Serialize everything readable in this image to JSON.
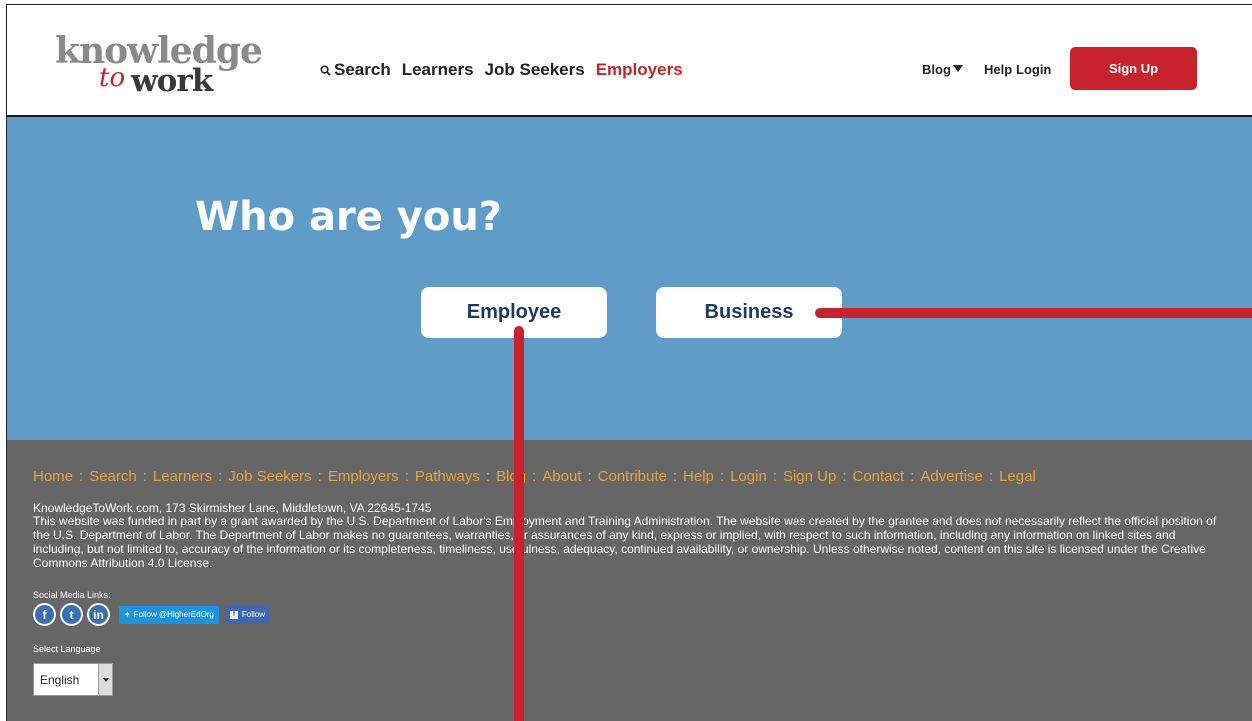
{
  "header": {
    "logo": {
      "top": "knowledge",
      "to": "to",
      "work": "work"
    },
    "nav": [
      {
        "label": "Search",
        "active": false,
        "icon": "search-icon"
      },
      {
        "label": "Learners",
        "active": false
      },
      {
        "label": "Job Seekers",
        "active": false
      },
      {
        "label": "Employers",
        "active": true
      }
    ],
    "right_nav": {
      "blog": "Blog",
      "help": "Help",
      "login": "Login"
    },
    "signup": "Sign Up"
  },
  "hero": {
    "title": "Who are you?",
    "employee": "Employee",
    "business": "Business"
  },
  "footer": {
    "links": [
      "Home",
      "Search",
      "Learners",
      "Job Seekers",
      "Employers",
      "Pathways",
      "Blog",
      "About",
      "Contribute",
      "Help",
      "Login",
      "Sign Up",
      "Contact",
      "Advertise",
      "Legal"
    ],
    "address": "KnowledgeToWork.com, 173 Skirmisher Lane, Middletown, VA 22645-1745",
    "disclaimer": "This website was funded in part by a grant awarded by the U.S. Department of Labor's Employment and Training Administration. The website was created by the grantee and does not necessarily reflect the official position of the U.S. Department of Labor. The Department of Labor makes no guarantees, warranties, or assurances of any kind, express or implied, with respect to such information, including any information on linked sites and including, but not limited to, accuracy of the information or its completeness, timeliness, usefulness, adequacy, continued availability, or ownership. Unless otherwise noted, content on this site is licensed under the Creative Commons Attribution 4.0 License.",
    "social_label": "Social Media Links:",
    "twitter_follow": "Follow @HigherEdOrg",
    "facebook_follow": "Follow",
    "language_label": "Select Language",
    "language_value": "English"
  },
  "colors": {
    "brand_red": "#c8232c",
    "hero_blue": "#5f9dc8",
    "footer_gray": "#666666",
    "link_orange": "#e8a33c"
  }
}
